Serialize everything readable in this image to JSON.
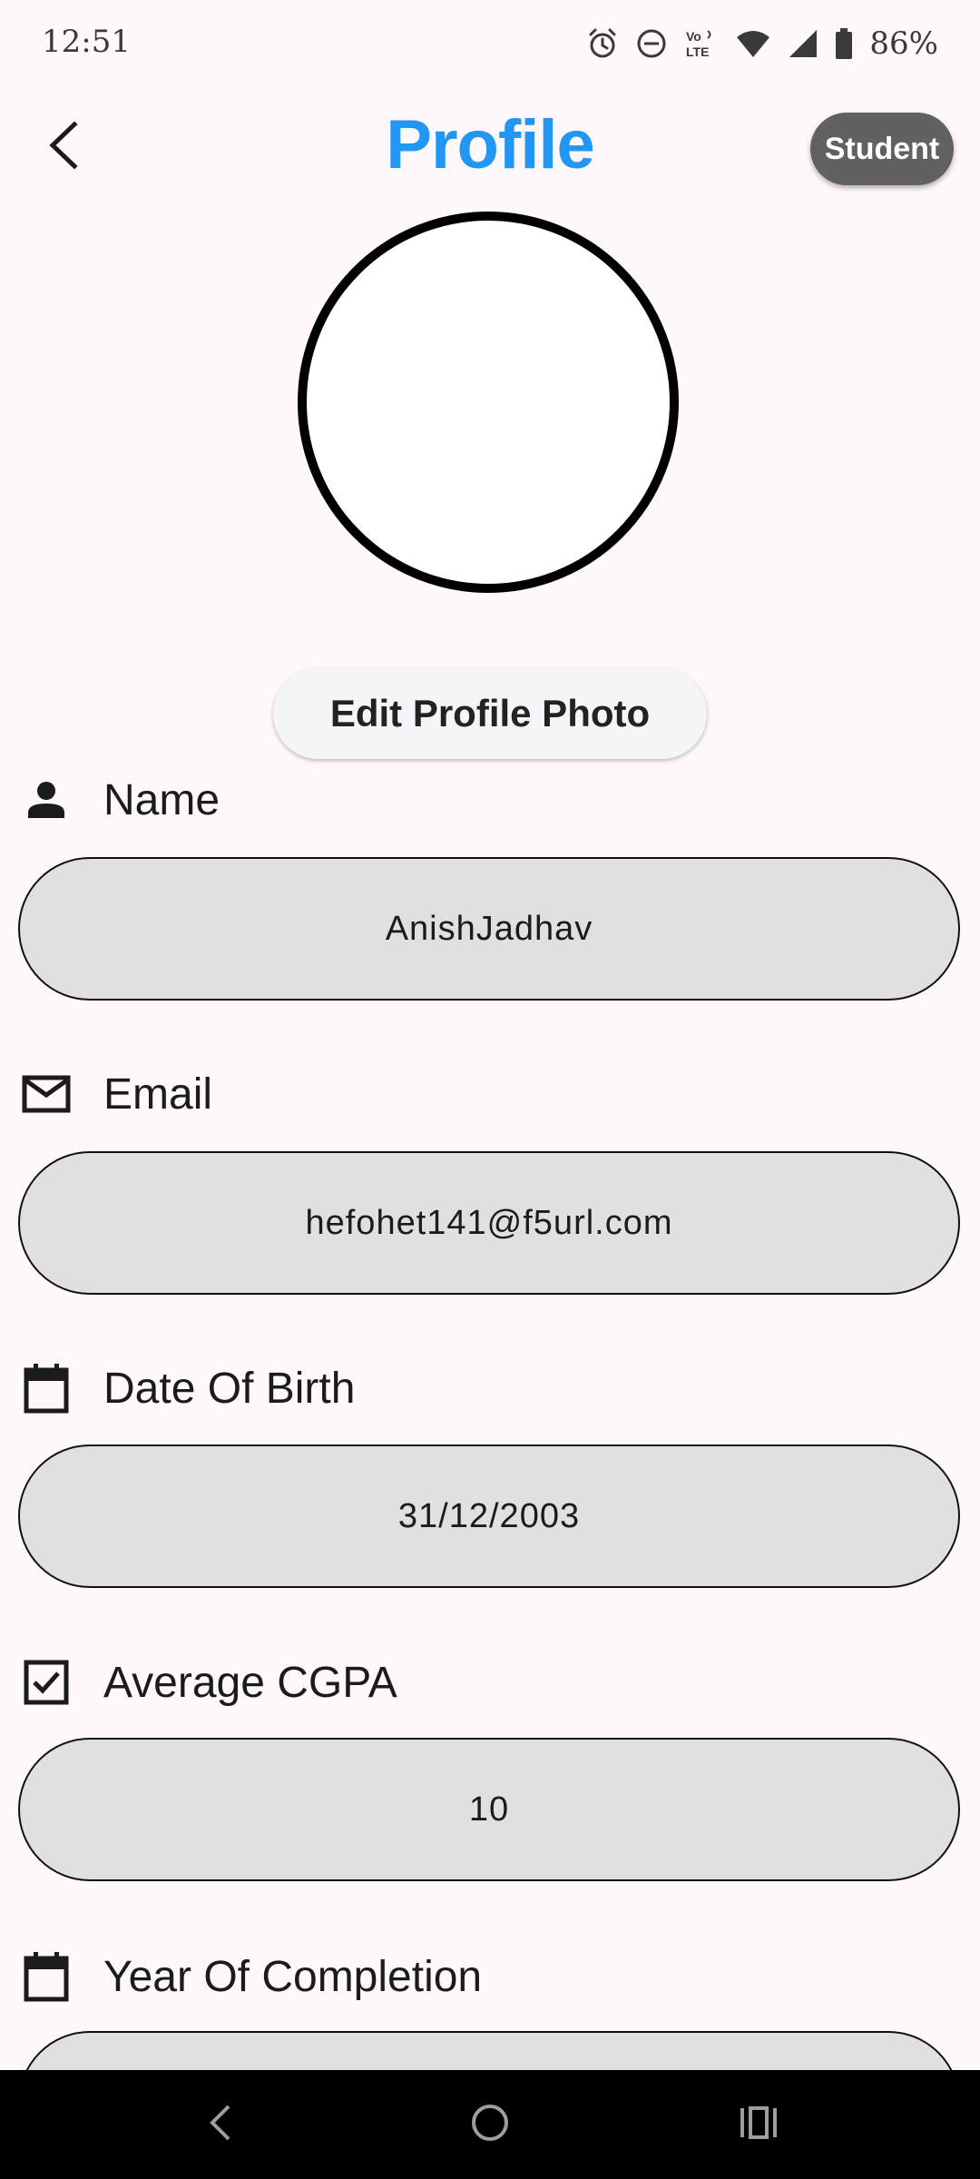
{
  "status_bar": {
    "time": "12:51",
    "battery_percent": "86%",
    "icons": [
      "alarm-icon",
      "do-not-disturb-icon",
      "volte-icon",
      "wifi-icon",
      "signal-icon",
      "battery-icon"
    ]
  },
  "header": {
    "title": "Profile",
    "role_badge": "Student",
    "back_icon": "back-arrow-icon",
    "title_color": "#2196F3"
  },
  "profile": {
    "edit_photo_label": "Edit Profile Photo"
  },
  "fields": {
    "name": {
      "label": "Name",
      "value": "AnishJadhav",
      "icon": "person-icon"
    },
    "email": {
      "label": "Email",
      "value": "hefohet141@f5url.com",
      "icon": "mail-icon"
    },
    "dob": {
      "label": "Date Of Birth",
      "value": "31/12/2003",
      "icon": "calendar-icon"
    },
    "cgpa": {
      "label": "Average CGPA",
      "value": "10",
      "icon": "checkbox-icon"
    },
    "year": {
      "label": "Year Of Completion",
      "value": "",
      "icon": "calendar-icon"
    }
  },
  "nav_bar": {
    "buttons": [
      "nav-back-icon",
      "nav-home-icon",
      "nav-recents-icon"
    ]
  }
}
